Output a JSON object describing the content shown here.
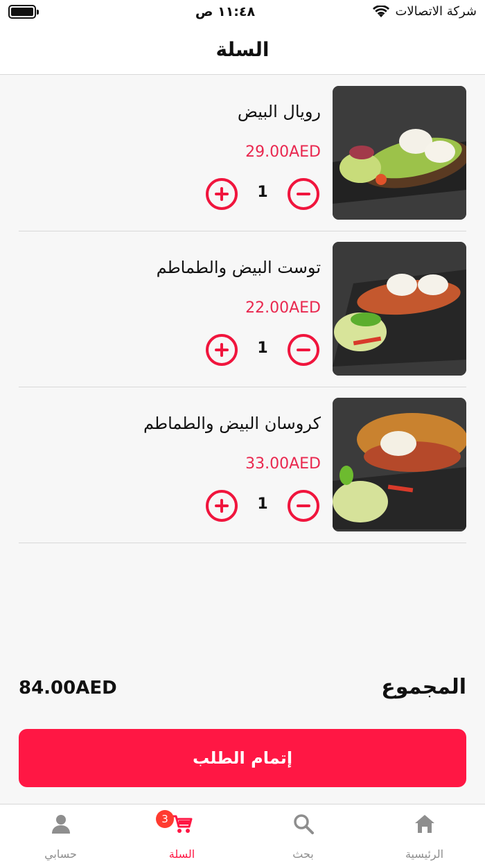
{
  "status_bar": {
    "time": "١١:٤٨ ص",
    "carrier": "شركة الاتصالات"
  },
  "header": {
    "title": "السلة"
  },
  "cart": {
    "items": [
      {
        "name": "رويال البيض",
        "price": "29.00AED",
        "quantity": "1"
      },
      {
        "name": "توست البيض والطماطم",
        "price": "22.00AED",
        "quantity": "1"
      },
      {
        "name": "كروسان البيض والطماطم",
        "price": "33.00AED",
        "quantity": "1"
      }
    ]
  },
  "summary": {
    "total_label": "المجموع",
    "total_value": "84.00AED"
  },
  "checkout": {
    "label": "إتمام الطلب"
  },
  "tabbar": {
    "tabs": [
      {
        "label": "الرئيسية",
        "icon": "home-icon"
      },
      {
        "label": "بحث",
        "icon": "search-icon"
      },
      {
        "label": "السلة",
        "icon": "cart-icon",
        "badge": "3",
        "active": true
      },
      {
        "label": "حسابي",
        "icon": "user-icon"
      }
    ]
  },
  "colors": {
    "accent": "#ff1744",
    "price": "#e9284f",
    "inactive": "#8e8e8e"
  }
}
